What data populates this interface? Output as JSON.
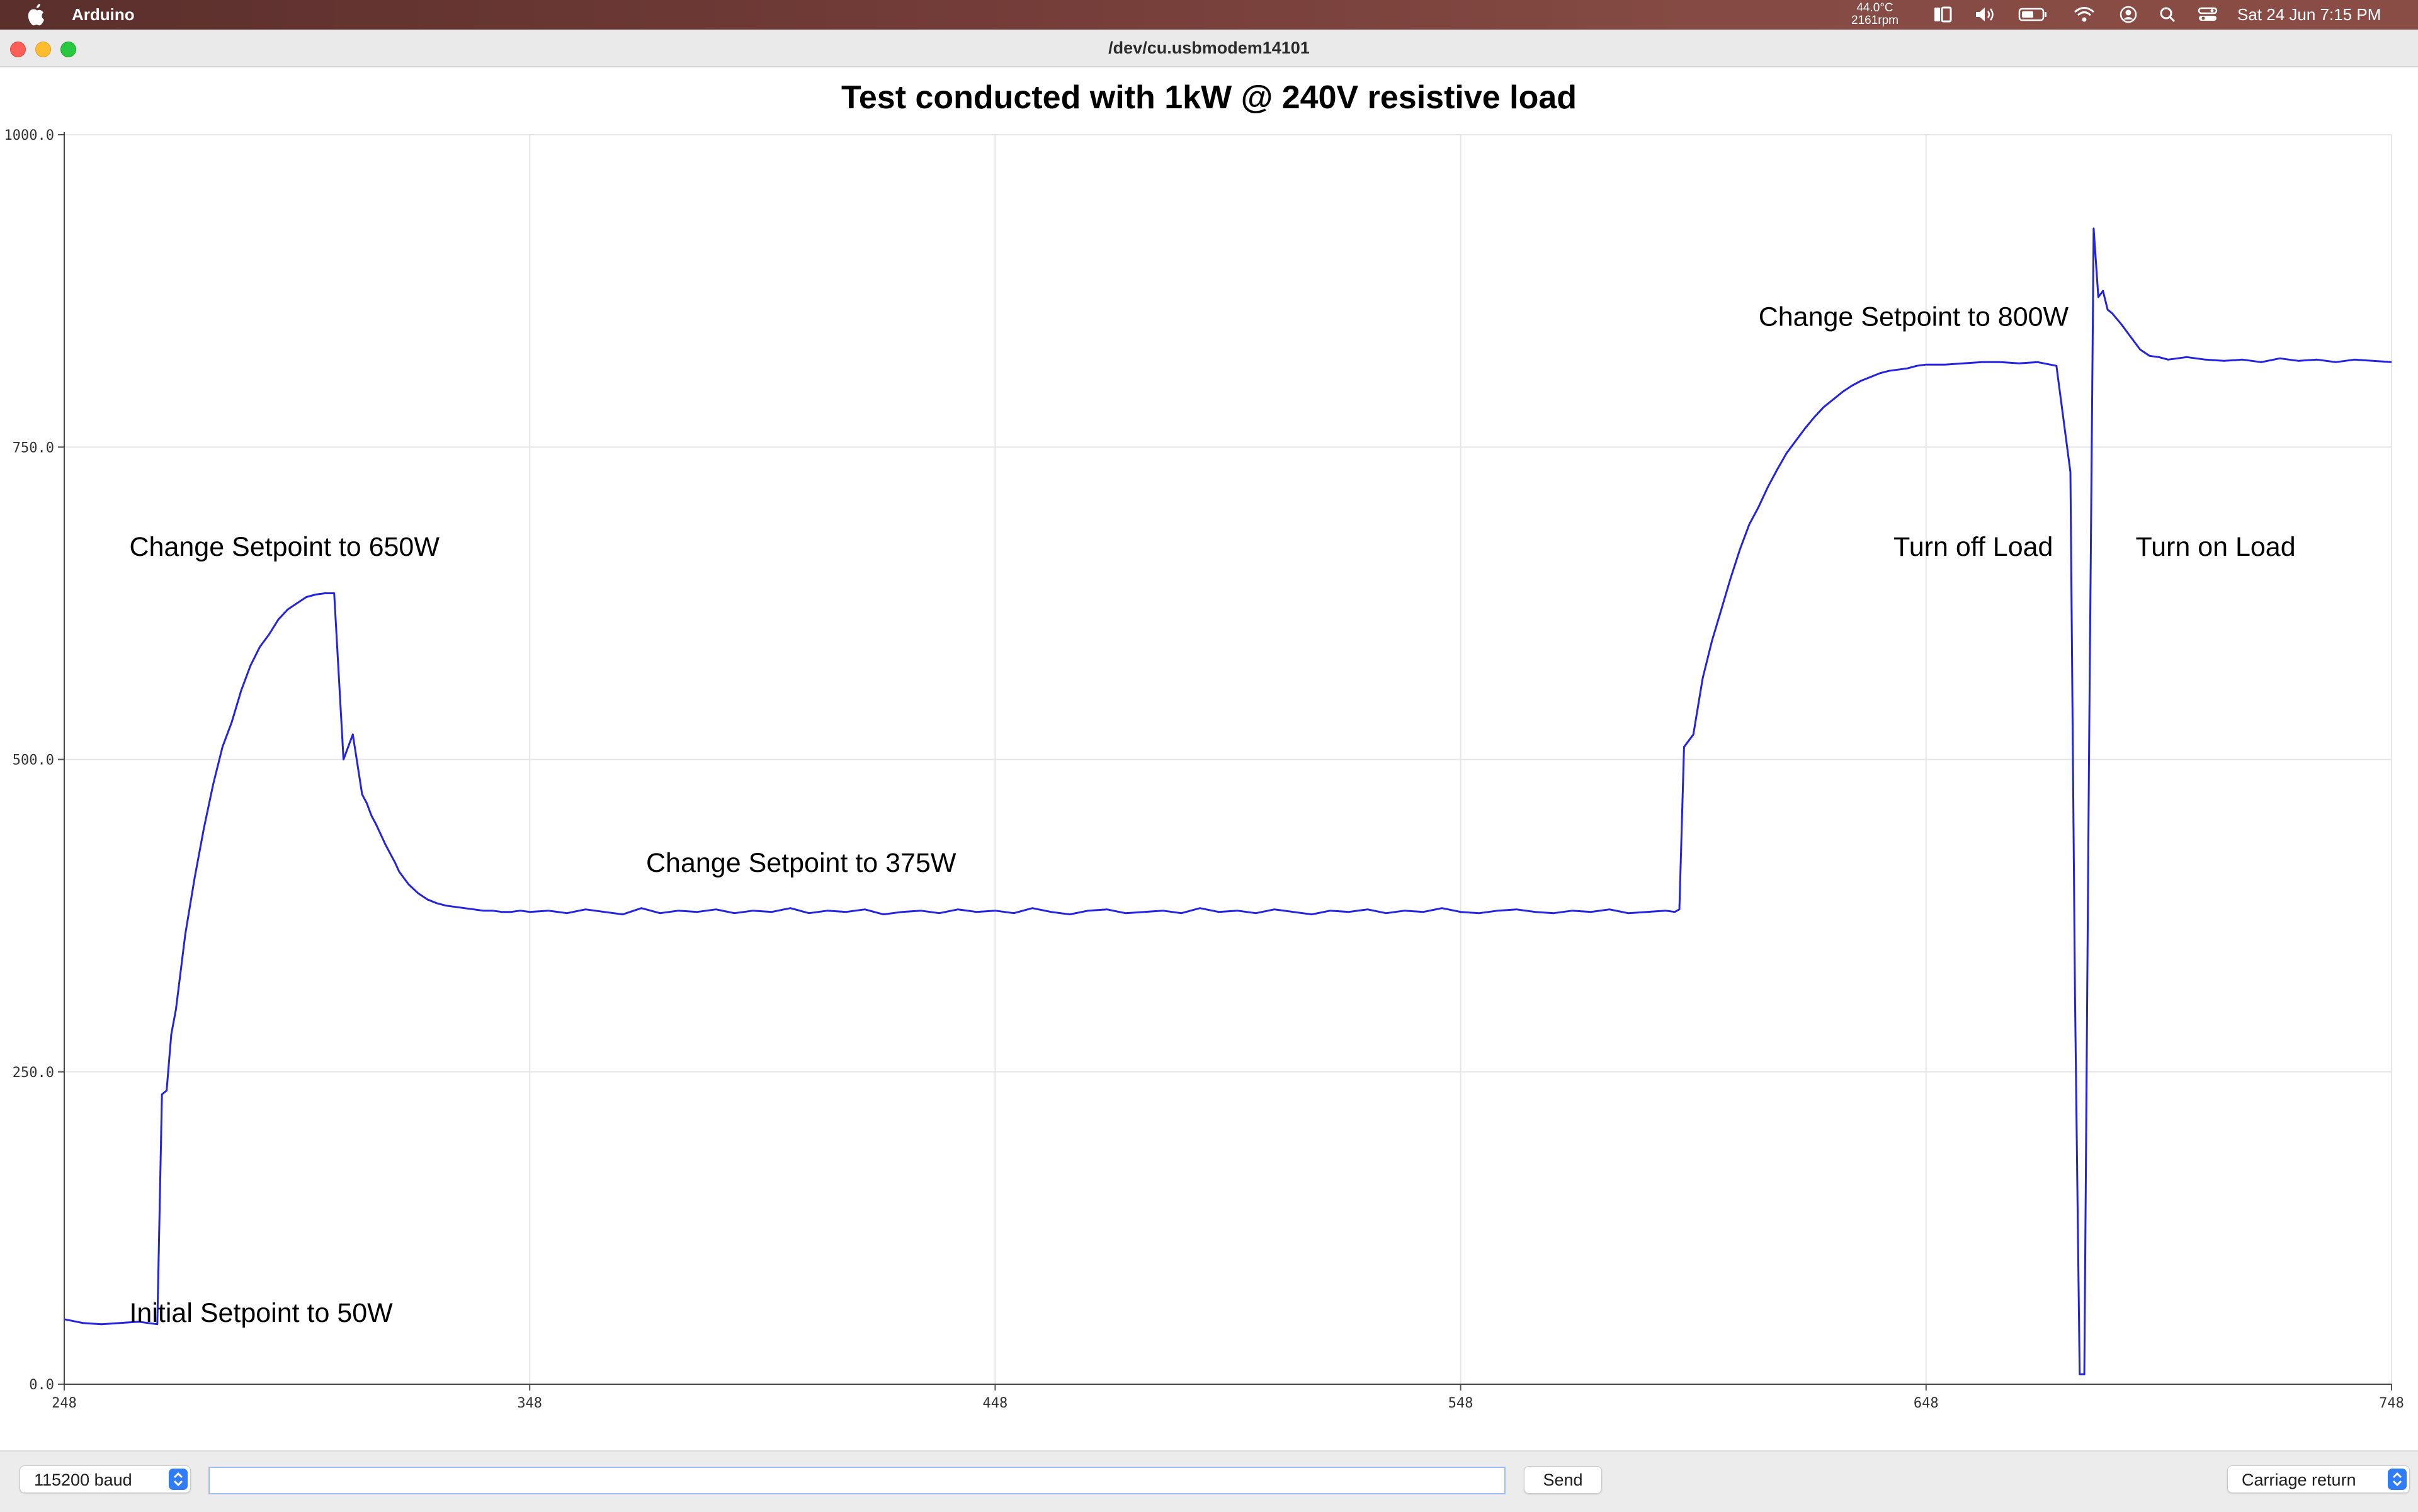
{
  "menubar": {
    "app_name": "Arduino",
    "temperature": "44.0°C",
    "fan_speed": "2161rpm",
    "clock": "Sat 24 Jun  7:15 PM",
    "icons": [
      "apple-icon",
      "stage-manager-icon",
      "volume-icon",
      "battery-icon",
      "wifi-icon",
      "user-icon",
      "search-icon",
      "control-center-icon"
    ]
  },
  "window": {
    "title": "/dev/cu.usbmodem14101"
  },
  "chart_data": {
    "type": "line",
    "title": "Test conducted with 1kW @ 240V resistive load",
    "xlabel": "",
    "ylabel": "",
    "xlim": [
      248,
      748
    ],
    "ylim": [
      0,
      1000
    ],
    "x_ticks": [
      "248",
      "348",
      "448",
      "548",
      "648",
      "748"
    ],
    "y_ticks": [
      "0.0",
      "250.0",
      "500.0",
      "750.0",
      "1000.0"
    ],
    "grid": true,
    "line_color": "#2323e0",
    "series": [
      {
        "x": [
          248,
          252,
          256,
          260,
          264,
          268,
          269,
          270,
          271,
          272,
          273,
          274,
          276,
          278,
          280,
          282,
          284,
          286,
          288,
          290,
          292,
          294,
          296,
          298,
          300,
          302,
          304,
          306,
          308,
          310,
          312,
          313,
          314,
          315,
          316,
          317,
          318,
          319,
          320,
          322,
          324,
          326,
          328,
          330,
          332,
          334,
          336,
          338,
          340,
          342,
          344,
          346,
          348,
          352,
          356,
          360,
          364,
          368,
          372,
          376,
          380,
          384,
          388,
          392,
          396,
          400,
          404,
          408,
          412,
          416,
          420,
          424,
          428,
          432,
          436,
          440,
          444,
          448,
          452,
          456,
          460,
          464,
          468,
          472,
          476,
          480,
          484,
          488,
          492,
          496,
          500,
          504,
          508,
          512,
          516,
          520,
          524,
          528,
          532,
          536,
          540,
          544,
          548,
          552,
          556,
          560,
          564,
          568,
          572,
          576,
          580,
          584,
          588,
          592,
          594,
          595,
          596,
          598,
          600,
          602,
          604,
          606,
          608,
          610,
          612,
          614,
          616,
          618,
          620,
          622,
          624,
          626,
          628,
          630,
          632,
          634,
          636,
          638,
          640,
          642,
          644,
          646,
          648,
          652,
          656,
          660,
          664,
          668,
          672,
          676,
          679,
          680,
          681,
          682,
          683,
          684,
          685,
          686,
          687,
          688,
          690,
          692,
          694,
          696,
          698,
          700,
          704,
          708,
          712,
          716,
          720,
          724,
          728,
          732,
          736,
          740,
          744,
          748
        ],
        "values": [
          52,
          49,
          48,
          49,
          50,
          48,
          232,
          235,
          280,
          300,
          330,
          360,
          405,
          445,
          480,
          510,
          530,
          555,
          575,
          590,
          600,
          612,
          620,
          625,
          630,
          632,
          633,
          633,
          500,
          520,
          472,
          465,
          455,
          448,
          440,
          432,
          425,
          418,
          410,
          400,
          393,
          388,
          385,
          383,
          382,
          381,
          380,
          379,
          379,
          378,
          378,
          379,
          378,
          379,
          377,
          380,
          378,
          376,
          381,
          377,
          379,
          378,
          380,
          377,
          379,
          378,
          381,
          377,
          379,
          378,
          380,
          376,
          378,
          379,
          377,
          380,
          378,
          379,
          377,
          381,
          378,
          376,
          379,
          380,
          377,
          378,
          379,
          377,
          381,
          378,
          379,
          377,
          380,
          378,
          376,
          379,
          378,
          380,
          377,
          379,
          378,
          381,
          378,
          377,
          379,
          380,
          378,
          377,
          379,
          378,
          380,
          377,
          378,
          379,
          378,
          380,
          510,
          520,
          565,
          595,
          620,
          645,
          668,
          688,
          702,
          718,
          732,
          745,
          755,
          765,
          774,
          782,
          788,
          794,
          799,
          803,
          806,
          809,
          811,
          812,
          813,
          815,
          816,
          816,
          817,
          818,
          818,
          817,
          818,
          815,
          730,
          310,
          8,
          8,
          500,
          925,
          870,
          875,
          860,
          857,
          848,
          838,
          828,
          823,
          822,
          820,
          822,
          820,
          819,
          820,
          818,
          821,
          819,
          820,
          818,
          820,
          819,
          818
        ]
      }
    ],
    "annotations": [
      {
        "text": "Initial Setpoint to 50W",
        "x": 262,
        "y": 50
      },
      {
        "text": "Change Setpoint to 650W",
        "x": 262,
        "y": 663
      },
      {
        "text": "Change Setpoint to 375W",
        "x": 373,
        "y": 410
      },
      {
        "text": "Change Setpoint to 800W",
        "x": 612,
        "y": 847
      },
      {
        "text": "Turn off Load",
        "x": 641,
        "y": 663
      },
      {
        "text": "Turn on Load",
        "x": 693,
        "y": 663
      }
    ]
  },
  "bottom": {
    "baud_label": "115200 baud",
    "input_value": "",
    "input_placeholder": "",
    "send_label": "Send",
    "line_ending_label": "Carriage return"
  }
}
